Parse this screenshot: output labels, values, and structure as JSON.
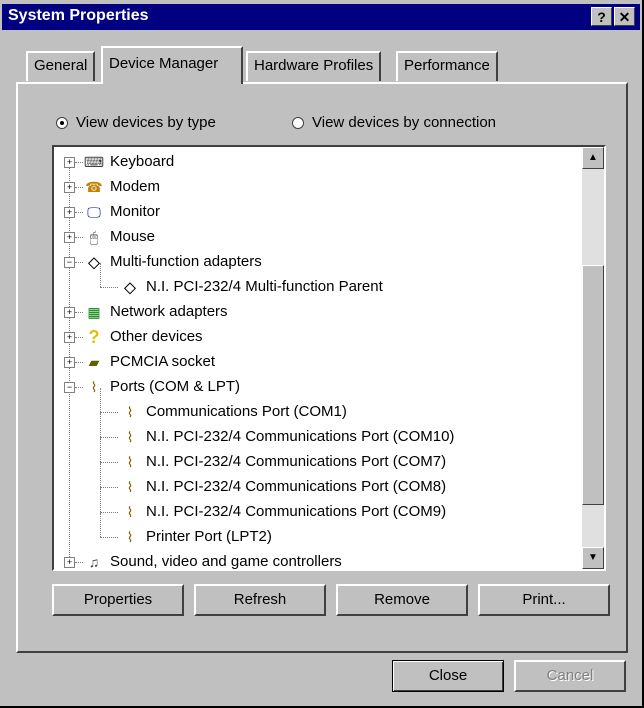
{
  "window": {
    "title": "System Properties",
    "help_glyph": "?",
    "close_glyph": "✕"
  },
  "tabs": [
    {
      "label": "General"
    },
    {
      "label": "Device Manager"
    },
    {
      "label": "Hardware Profiles"
    },
    {
      "label": "Performance"
    }
  ],
  "view_options": {
    "by_type": "View devices by type",
    "by_connection": "View devices by connection",
    "selected": "by_type"
  },
  "tree": {
    "items": [
      {
        "label": "Keyboard",
        "icon": "keyboard-icon",
        "expander": "+"
      },
      {
        "label": "Modem",
        "icon": "modem-icon",
        "expander": "+"
      },
      {
        "label": "Monitor",
        "icon": "monitor-icon",
        "expander": "+"
      },
      {
        "label": "Mouse",
        "icon": "mouse-icon",
        "expander": "+"
      },
      {
        "label": "Multi-function adapters",
        "icon": "multifunction-icon",
        "expander": "−"
      },
      {
        "label": "N.I. PCI-232/4 Multi-function Parent",
        "icon": "multifunction-icon"
      },
      {
        "label": "Network adapters",
        "icon": "network-card-icon",
        "expander": "+"
      },
      {
        "label": "Other devices",
        "icon": "question-icon",
        "expander": "+"
      },
      {
        "label": "PCMCIA socket",
        "icon": "pcmcia-icon",
        "expander": "+"
      },
      {
        "label": "Ports (COM & LPT)",
        "icon": "port-cable-icon",
        "expander": "−"
      },
      {
        "label": "Communications Port (COM1)",
        "icon": "port-cable-icon"
      },
      {
        "label": "N.I. PCI-232/4 Communications Port (COM10)",
        "icon": "port-cable-icon"
      },
      {
        "label": "N.I. PCI-232/4 Communications Port (COM7)",
        "icon": "port-cable-icon"
      },
      {
        "label": "N.I. PCI-232/4 Communications Port (COM8)",
        "icon": "port-cable-icon"
      },
      {
        "label": "N.I. PCI-232/4 Communications Port (COM9)",
        "icon": "port-cable-icon"
      },
      {
        "label": "Printer Port (LPT2)",
        "icon": "port-cable-icon"
      },
      {
        "label": "Sound, video and game controllers",
        "icon": "sound-icon",
        "expander": "+"
      }
    ]
  },
  "actions": {
    "properties": "Properties",
    "refresh": "Refresh",
    "remove": "Remove",
    "print": "Print..."
  },
  "footer": {
    "close": "Close",
    "cancel": "Cancel"
  },
  "colors": {
    "titlebar": "#000080",
    "face": "#c0c0c0"
  }
}
